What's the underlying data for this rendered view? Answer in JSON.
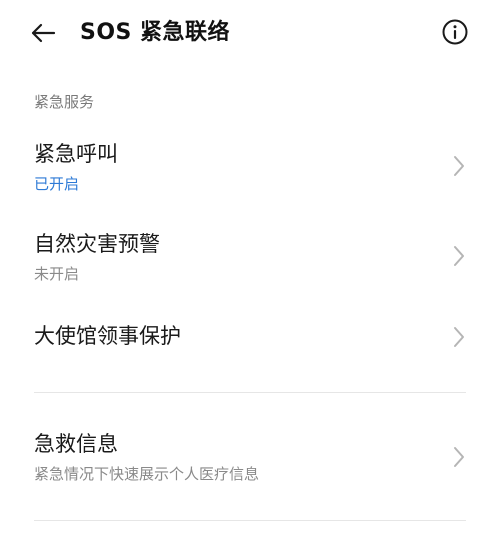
{
  "header": {
    "title": "SOS 紧急联络",
    "back_icon": "arrow-left-icon",
    "info_icon": "info-circle-icon"
  },
  "section": {
    "title": "紧急服务"
  },
  "items": [
    {
      "title": "紧急呼叫",
      "subtitle": "已开启",
      "status_color": "#2d7ad6"
    },
    {
      "title": "自然灾害预警",
      "subtitle": "未开启"
    },
    {
      "title": "大使馆领事保护"
    },
    {
      "title": "急救信息",
      "subtitle": "紧急情况下快速展示个人医疗信息"
    }
  ],
  "colors": {
    "accent": "#2d7ad6",
    "secondary_text": "#8a8a8a",
    "divider": "#e6e6e6"
  }
}
